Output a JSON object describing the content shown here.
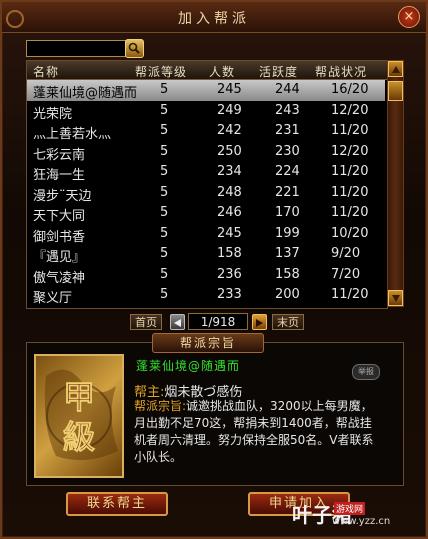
{
  "window": {
    "title": "加入帮派",
    "close": "×"
  },
  "search": {
    "value": "",
    "placeholder": ""
  },
  "table": {
    "headers": [
      "名称",
      "帮派等级",
      "人数",
      "活跃度",
      "帮战状况"
    ],
    "rows": [
      [
        "蓬莱仙境@随遇而",
        "5",
        "245",
        "244",
        "16/20"
      ],
      [
        "光荣院",
        "5",
        "249",
        "243",
        "12/20"
      ],
      [
        "灬上善若水灬",
        "5",
        "242",
        "231",
        "11/20"
      ],
      [
        "七彩云南",
        "5",
        "250",
        "230",
        "12/20"
      ],
      [
        "狂海一生",
        "5",
        "234",
        "224",
        "11/20"
      ],
      [
        "漫步¨天边",
        "5",
        "248",
        "221",
        "11/20"
      ],
      [
        "天下大同",
        "5",
        "246",
        "170",
        "11/20"
      ],
      [
        "御剑书香",
        "5",
        "245",
        "199",
        "10/20"
      ],
      [
        "『遇见』",
        "5",
        "158",
        "137",
        "9/20"
      ],
      [
        "傲气凌神",
        "5",
        "236",
        "158",
        "7/20"
      ],
      [
        "聚义厅",
        "5",
        "233",
        "200",
        "11/20"
      ]
    ],
    "selected_row": 0
  },
  "pager": {
    "first": "首页",
    "info": "1/918",
    "last": "末页"
  },
  "detail": {
    "header": "帮派宗旨",
    "emblem_text": "甲級",
    "guild_name": "蓬莱仙境@随遇而",
    "stamp": "举报",
    "leader_label": "帮主:",
    "leader": "烟未散づ感伤",
    "desc_label": "帮派宗旨:",
    "desc": "诚邀挑战血队，3200以上每男魔，月出勤不足70这，帮捐未到1400者，帮战挂机者周六清理。努力保持全服50名。V者联系小队长。"
  },
  "buttons": {
    "contact": "联系帮主",
    "apply": "申请加入"
  },
  "watermark": {
    "brand": "叶子猪",
    "tag": "游戏网",
    "url": "www.yzz.cn"
  },
  "colors": {
    "accent": "#e2a42a",
    "guild_name": "#30e030",
    "selected_row": "#a8a8a8"
  }
}
